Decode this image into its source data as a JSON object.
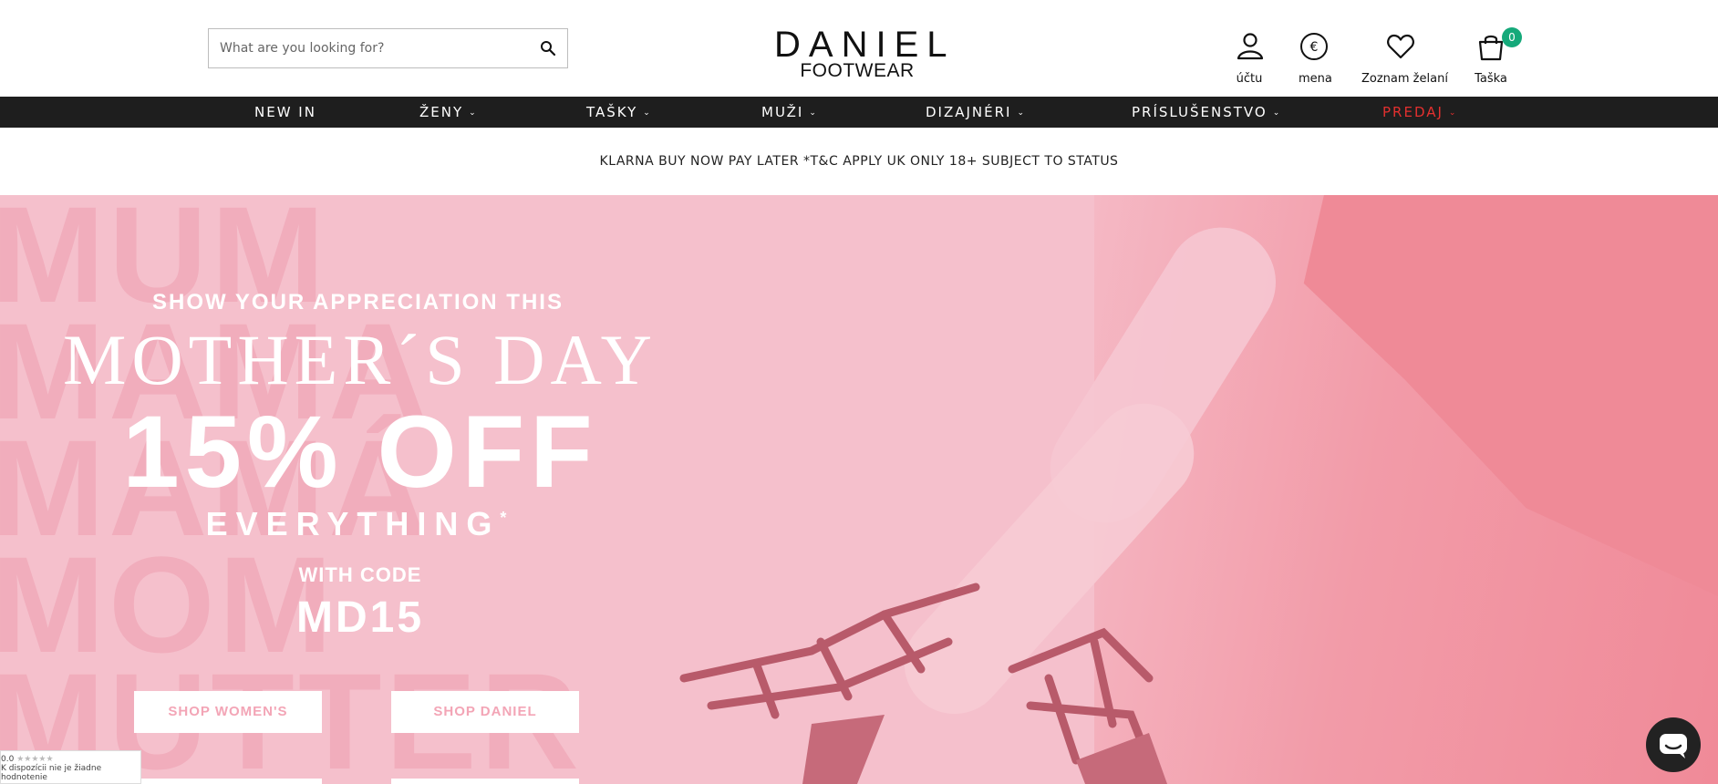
{
  "search": {
    "placeholder": "What are you looking for?"
  },
  "logo": {
    "line1": "DANIEL",
    "line2": "FOOTWEAR"
  },
  "header_icons": [
    {
      "label": "účtu",
      "icon": "user-icon"
    },
    {
      "label": "mena",
      "icon": "euro-icon"
    },
    {
      "label": "Zoznam želaní",
      "icon": "heart-icon"
    },
    {
      "label": "Taška",
      "icon": "bag-icon",
      "badge": "0"
    }
  ],
  "nav": {
    "items": [
      {
        "label": "NEW IN"
      },
      {
        "label": "ŽENY",
        "chevron": "⌄"
      },
      {
        "label": "TAŠKY",
        "chevron": "⌄"
      },
      {
        "label": "MUŽI",
        "chevron": "⌄"
      },
      {
        "label": "DIZAJNÉRI",
        "chevron": "⌄"
      },
      {
        "label": "PRÍSLUŠENSTVO",
        "chevron": "⌄"
      },
      {
        "label": "PREDAJ",
        "chevron": "⌄"
      }
    ],
    "sale_color": "#e3302f"
  },
  "promo": {
    "text": "KLARNA BUY NOW PAY LATER *T&C APPLY UK ONLY 18+ SUBJECT TO STATUS"
  },
  "hero": {
    "background_words": [
      "MUM",
      "MAMA",
      "MAMÁ",
      "MOM",
      "MUTTER"
    ],
    "line1": "SHOW YOUR APPRECIATION THIS",
    "line2": "MOTHER´S DAY",
    "line3": "15% OFF",
    "line4": "EVERYTHING",
    "line4_mark": "*",
    "line5": "WITH CODE",
    "line6": "MD15",
    "buttons": [
      {
        "label": "SHOP WOMEN'S"
      },
      {
        "label": "SHOP DANIEL"
      }
    ],
    "colors": {
      "pink": "#f5c0cc",
      "accent_text": "#f3a5b6"
    }
  },
  "reviews_widget": {
    "score": "0.0",
    "stars": "★★★★★",
    "text": "K dispozícii nie je žiadne hodnotenie"
  },
  "chat": {
    "icon": "chat-icon"
  },
  "badge_color": "#15a97a"
}
